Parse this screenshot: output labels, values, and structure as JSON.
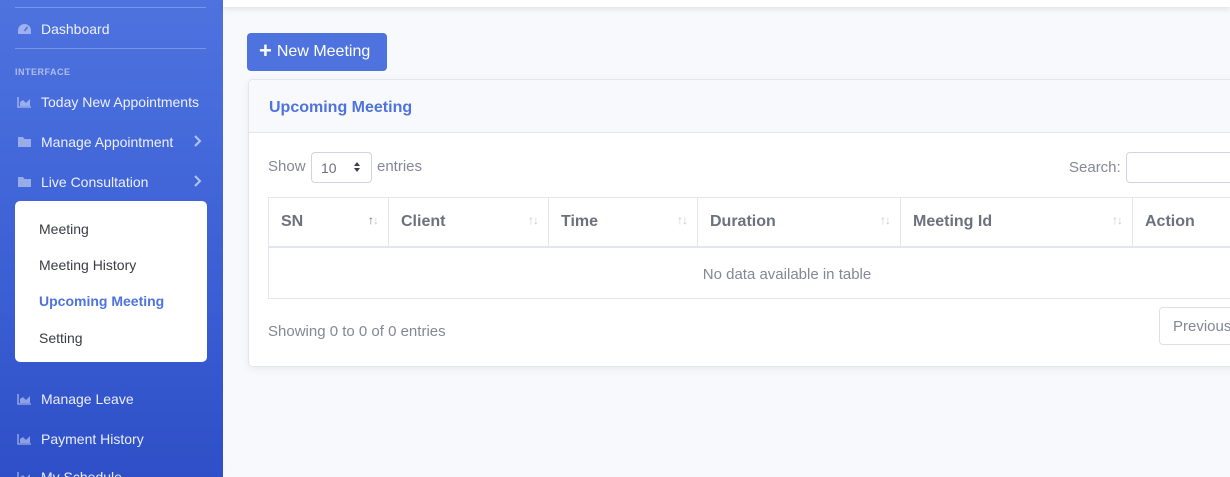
{
  "sidebar": {
    "dashboard": "Dashboard",
    "heading": "INTERFACE",
    "items": [
      {
        "label": "Today New Appointments"
      },
      {
        "label": "Manage Appointment"
      },
      {
        "label": "Live Consultation"
      },
      {
        "label": "Manage Leave"
      },
      {
        "label": "Payment History"
      },
      {
        "label": "My Schedule"
      }
    ],
    "submenu": [
      {
        "label": "Meeting"
      },
      {
        "label": "Meeting History"
      },
      {
        "label": "Upcoming Meeting",
        "active": true
      },
      {
        "label": "Setting"
      }
    ]
  },
  "toolbar": {
    "new_meeting": "New Meeting"
  },
  "card": {
    "title": "Upcoming Meeting",
    "show": "Show",
    "length_value": "10",
    "entries": "entries",
    "search_label": "Search:",
    "columns": [
      "SN",
      "Client",
      "Time",
      "Duration",
      "Meeting Id",
      "Action"
    ],
    "empty_message": "No data available in table",
    "info": "Showing 0 to 0 of 0 entries",
    "previous": "Previous"
  },
  "colors": {
    "primary": "#4e73df",
    "text": "#858796",
    "border": "#e3e6f0"
  }
}
